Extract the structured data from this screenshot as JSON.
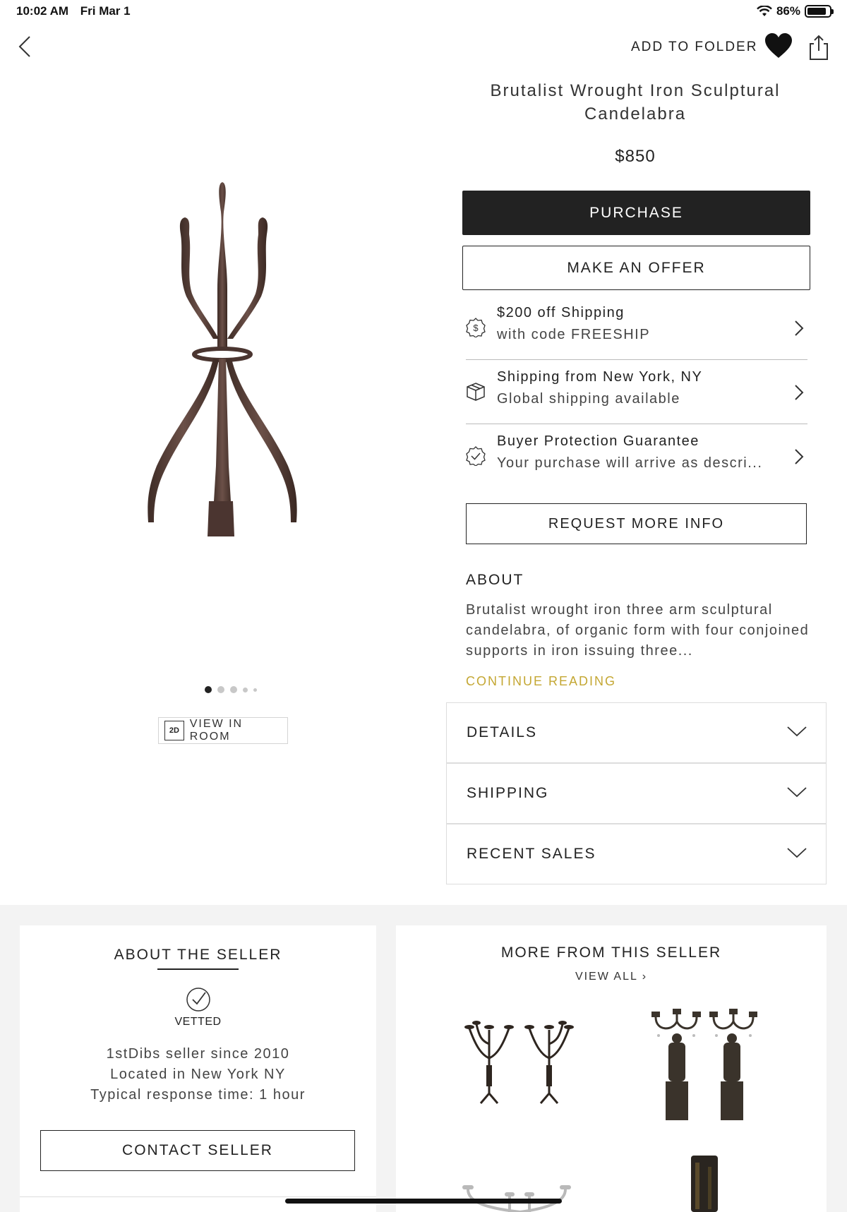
{
  "status_bar": {
    "time": "10:02 AM",
    "date": "Fri Mar 1",
    "battery": "86%",
    "battery_level": 0.86
  },
  "nav": {
    "add_to_folder": "ADD TO FOLDER",
    "icons": [
      "back-chevron-icon",
      "heart-icon",
      "share-icon"
    ]
  },
  "product": {
    "title": "Brutalist Wrought Iron Sculptural Candelabra",
    "price": "$850",
    "purchase_label": "PURCHASE",
    "offer_label": "MAKE AN OFFER",
    "image_dots": 5,
    "active_dot": 1,
    "view_in_room_badge": "2D",
    "view_in_room_label": "VIEW IN ROOM"
  },
  "info_rows": [
    {
      "icon": "dollar-badge-icon",
      "line1": "$200 off Shipping",
      "line2": "with code FREESHIP"
    },
    {
      "icon": "box-icon",
      "line1": "Shipping from New York, NY",
      "line2": "Global shipping available"
    },
    {
      "icon": "check-badge-icon",
      "line1": "Buyer Protection Guarantee",
      "line2": "Your purchase will arrive as descri..."
    }
  ],
  "request_info_label": "REQUEST MORE INFO",
  "about": {
    "heading": "ABOUT",
    "text": "Brutalist wrought iron three arm sculptural candelabra, of organic form with four conjoined supports in iron issuing three...",
    "continue_label": "CONTINUE READING"
  },
  "accordions": [
    {
      "label": "DETAILS"
    },
    {
      "label": "SHIPPING"
    },
    {
      "label": "RECENT SALES"
    }
  ],
  "seller": {
    "heading": "ABOUT THE SELLER",
    "vetted_label": "VETTED",
    "since": "1stDibs seller since 2010",
    "location": "Located in New York NY",
    "response": "Typical response time: 1 hour",
    "contact_label": "CONTACT SELLER"
  },
  "more_from_seller": {
    "heading": "MORE FROM THIS SELLER",
    "view_all_label": "VIEW ALL",
    "items": [
      "pair-of-iron-candelabras",
      "pair-of-figural-bronze-candelabras",
      "silver-candelabra",
      "dark-iron-sculpture"
    ]
  },
  "colors": {
    "accent_gold": "#c4a733",
    "primary_dark": "#222222",
    "band_grey": "#f3f3f3"
  }
}
